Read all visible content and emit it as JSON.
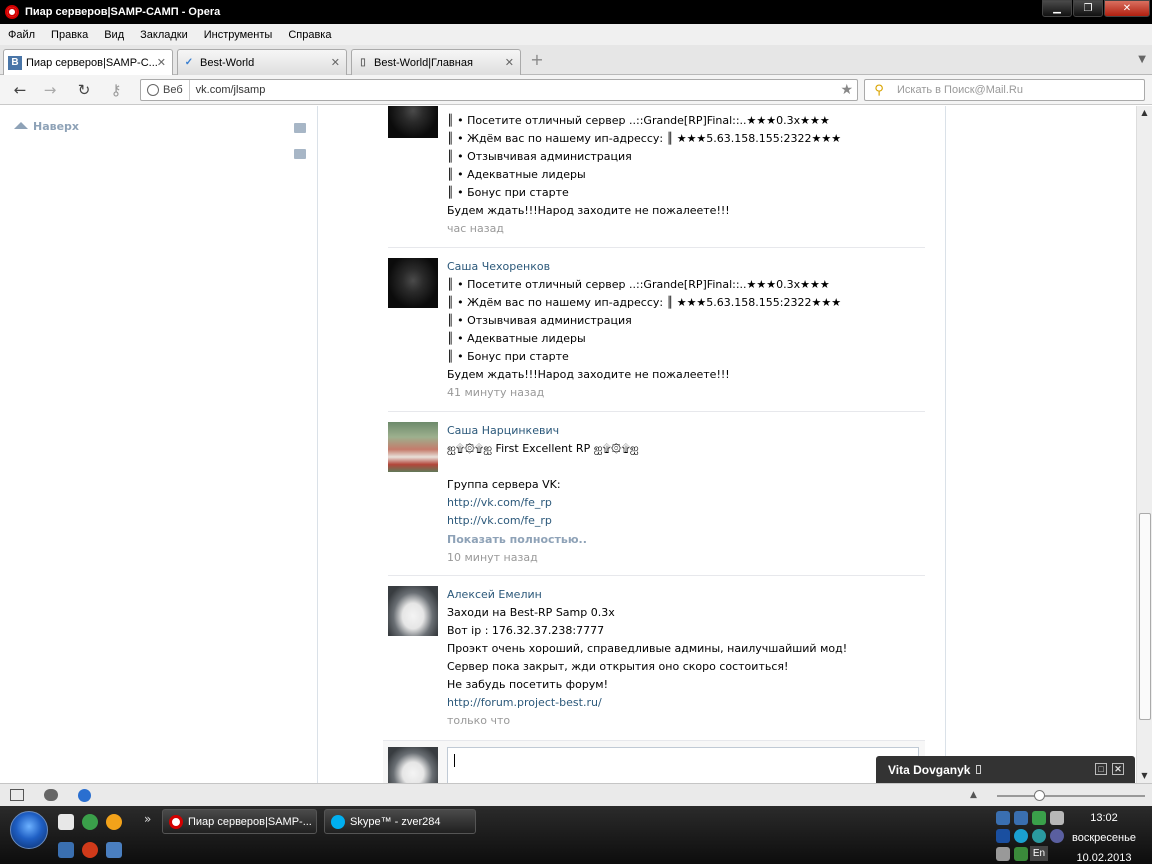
{
  "window": {
    "title": "Пиар серверов|SAMP-САМП - Opera",
    "minimize": "▁",
    "maximize": "❐",
    "close": "✕"
  },
  "menu": [
    "Файл",
    "Правка",
    "Вид",
    "Закладки",
    "Инструменты",
    "Справка"
  ],
  "tabs": [
    {
      "label": "Пиар серверов|SAMP-С...",
      "favicon": "B",
      "close": "✕"
    },
    {
      "label": "Best-World",
      "favicon": "✓",
      "close": "✕"
    },
    {
      "label": "Best-World|Главная",
      "favicon": "▯",
      "close": "✕"
    }
  ],
  "toolbar": {
    "back": "←",
    "forward": "→",
    "reload": "↻",
    "key": "⚷",
    "badge": "Веб",
    "url": "vk.com/jlsamp",
    "star": "★",
    "search_placeholder": "Искать в Поиск@Mail.Ru",
    "search_icon": "⚲"
  },
  "sidebar": {
    "up_label": "Наверх"
  },
  "posts": [
    {
      "author": "",
      "lines": [
        "║ • Посетите отличный сервер ..::Grande[RP]Final::..★★★0.3x★★★",
        "║ • Ждём вас по нашему ип-адрессу: ║ ★★★5.63.158.155:2322★★★",
        "║ • Отзывчивая администрация",
        "║ • Адекватные лидеры",
        "║ • Бонус при старте",
        "Будем ждать!!!Народ заходите не пожалеете!!!"
      ],
      "time": "час назад"
    },
    {
      "author": "Саша Чехоренков",
      "lines": [
        "║ • Посетите отличный сервер ..::Grande[RP]Final::..★★★0.3x★★★",
        "║ • Ждём вас по нашему ип-адрессу: ║ ★★★5.63.158.155:2322★★★",
        "║ • Отзывчивая администрация",
        "║ • Адекватные лидеры",
        "║ • Бонус при старте",
        "Будем ждать!!!Народ заходите не пожалеете!!!"
      ],
      "time": "41 минуту назад"
    },
    {
      "author": "Саша Нарцинкевич",
      "lines": [
        "ஐ۩۞۩ஐ First Excellent RP ஐ۩۞۩ஐ",
        "",
        "Группа сервера VK:"
      ],
      "links": [
        "http://vk.com/fe_rp",
        "http://vk.com/fe_rp"
      ],
      "more": "Показать полностью..",
      "time": "10 минут назад"
    },
    {
      "author": "Алексей Емелин",
      "lines": [
        "Заходи на Best-RP Samp 0.3x",
        "Вот ip : 176.32.37.238:7777",
        "Проэкт очень хороший, справедливые админы, наилучшайший мод!",
        "Сервер пока закрыт, жди открытия оно скоро состоиться!",
        "Не забудь посетить форум!"
      ],
      "links": [
        "http://forum.project-best.ru/"
      ],
      "time": "только что"
    }
  ],
  "chat": {
    "name": "Vita Dovganyk",
    "btn_restore": "□",
    "btn_close": "✕"
  },
  "taskbar": {
    "items": [
      {
        "label": "Пиар серверов|SAMP-..."
      },
      {
        "label": "Skype™ - zver284"
      }
    ],
    "overflow": "»",
    "lang": "En",
    "time": "13:02",
    "day": "воскресенье",
    "date": "10.02.2013"
  },
  "colors": {
    "link": "#2b587a",
    "muted": "#999999",
    "up": "#8ea2b7"
  }
}
